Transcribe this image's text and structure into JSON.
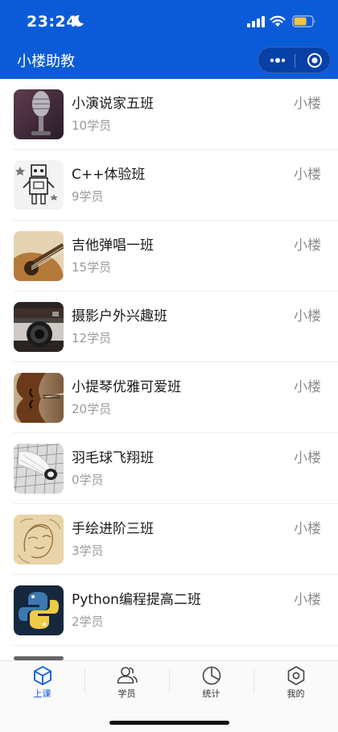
{
  "status_bar": {
    "time": "23:24"
  },
  "nav": {
    "title": "小楼助教"
  },
  "classes": [
    {
      "name": "小演说家五班",
      "count": "10学员",
      "teacher": "小楼",
      "image": "microphone"
    },
    {
      "name": "C++体验班",
      "count": "9学员",
      "teacher": "小楼",
      "image": "robot-drawing"
    },
    {
      "name": "吉他弹唱一班",
      "count": "15学员",
      "teacher": "小楼",
      "image": "guitar"
    },
    {
      "name": "摄影户外兴趣班",
      "count": "12学员",
      "teacher": "小楼",
      "image": "camera"
    },
    {
      "name": "小提琴优雅可爱班",
      "count": "20学员",
      "teacher": "小楼",
      "image": "violin"
    },
    {
      "name": "羽毛球飞翔班",
      "count": "0学员",
      "teacher": "小楼",
      "image": "shuttlecock"
    },
    {
      "name": "手绘进阶三班",
      "count": "3学员",
      "teacher": "小楼",
      "image": "sketch"
    },
    {
      "name": "Python编程提高二班",
      "count": "2学员",
      "teacher": "小楼",
      "image": "python-logo"
    }
  ],
  "tabbar": {
    "tabs": [
      {
        "label": "上课",
        "icon": "cube-icon",
        "active": true
      },
      {
        "label": "学员",
        "icon": "students-icon",
        "active": false
      },
      {
        "label": "统计",
        "icon": "pie-chart-icon",
        "active": false
      },
      {
        "label": "我的",
        "icon": "hexagon-settings-icon",
        "active": false
      }
    ]
  },
  "colors": {
    "primary": "#0b5bd9",
    "text": "#1a1a1a",
    "muted": "#9a9a9a"
  }
}
